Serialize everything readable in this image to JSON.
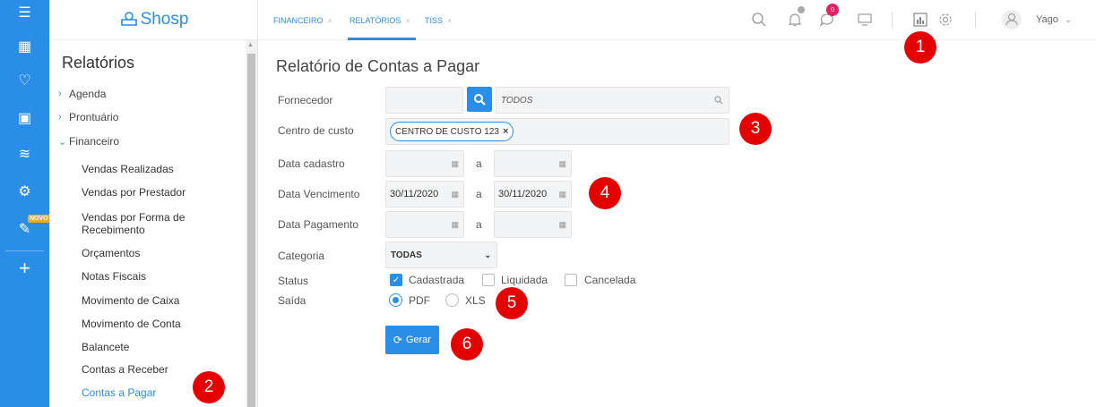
{
  "rail": {
    "items": [
      {
        "icon": "☰"
      },
      {
        "icon": "▦"
      },
      {
        "icon": "♡"
      },
      {
        "icon": "▣"
      },
      {
        "icon": "≋"
      },
      {
        "icon": "⚙"
      },
      {
        "icon": "✎"
      },
      {
        "icon": "+"
      }
    ],
    "novo_badge": "NOVO"
  },
  "logo": {
    "text": "Shosp"
  },
  "sidebar": {
    "title": "Relatórios",
    "parents": [
      {
        "label": "Agenda",
        "chev": "›"
      },
      {
        "label": "Prontuário",
        "chev": "›"
      },
      {
        "label": "Financeiro",
        "chev": "⌄"
      }
    ],
    "children": [
      "Vendas Realizadas",
      "Vendas por Prestador",
      "Vendas por Forma de Recebimento",
      "Orçamentos",
      "Notas Fiscais",
      "Movimento de Caixa",
      "Movimento de Conta",
      "Balancete",
      "Contas a Receber",
      "Contas a Pagar"
    ]
  },
  "tabs": [
    {
      "label": "FINANCEIRO",
      "close": "×"
    },
    {
      "label": "RELATÓRIOS",
      "close": "×"
    },
    {
      "label": "TISS",
      "close": "×"
    }
  ],
  "topbar": {
    "notif_count": "0",
    "user_name": "Yago",
    "user_chevron": "⌄"
  },
  "form": {
    "title": "Relatório de Contas a Pagar",
    "labels": {
      "fornecedor": "Fornecedor",
      "centro": "Centro de custo",
      "cadastro": "Data cadastro",
      "vencimento": "Data Vencimento",
      "pagamento": "Data Pagamento",
      "categoria": "Categoria",
      "status": "Status",
      "saida": "Saída"
    },
    "range_sep": "a",
    "fornecedor_placeholder": "TODOS",
    "centro_chip": "CENTRO DE CUSTO 123",
    "venc_from": "30/11/2020",
    "venc_to": "30/11/2020",
    "categoria_value": "TODAS",
    "status_options": [
      "Cadastrada",
      "Liquidada",
      "Cancelada"
    ],
    "saida_options": [
      "PDF",
      "XLS"
    ],
    "gerar_label": "Gerar"
  },
  "markers": [
    "1",
    "2",
    "3",
    "4",
    "5",
    "6"
  ]
}
